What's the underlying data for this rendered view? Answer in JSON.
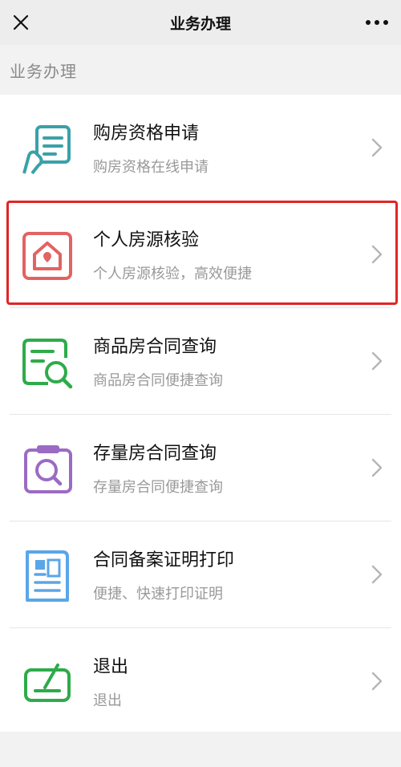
{
  "header": {
    "title": "业务办理",
    "close_icon": "close-icon",
    "more_icon": "more-icon"
  },
  "section": {
    "label": "业务办理"
  },
  "colors": {
    "teal": "#3aa1a8",
    "red": "#e26363",
    "green": "#2eab4a",
    "purple": "#9b6bc4",
    "blue": "#5aa6e8",
    "highlight": "#e32424"
  },
  "items": [
    {
      "title": "购房资格申请",
      "subtitle": "购房资格在线申请",
      "icon": "document-hand-icon"
    },
    {
      "title": "个人房源核验",
      "subtitle": "个人房源核验，高效便捷",
      "icon": "house-icon",
      "highlighted": true
    },
    {
      "title": "商品房合同查询",
      "subtitle": "商品房合同便捷查询",
      "icon": "document-search-icon"
    },
    {
      "title": "存量房合同查询",
      "subtitle": "存量房合同便捷查询",
      "icon": "clipboard-search-icon"
    },
    {
      "title": "合同备案证明打印",
      "subtitle": "便捷、快速打印证明",
      "icon": "certificate-icon"
    },
    {
      "title": "退出",
      "subtitle": "退出",
      "icon": "exit-icon"
    }
  ]
}
